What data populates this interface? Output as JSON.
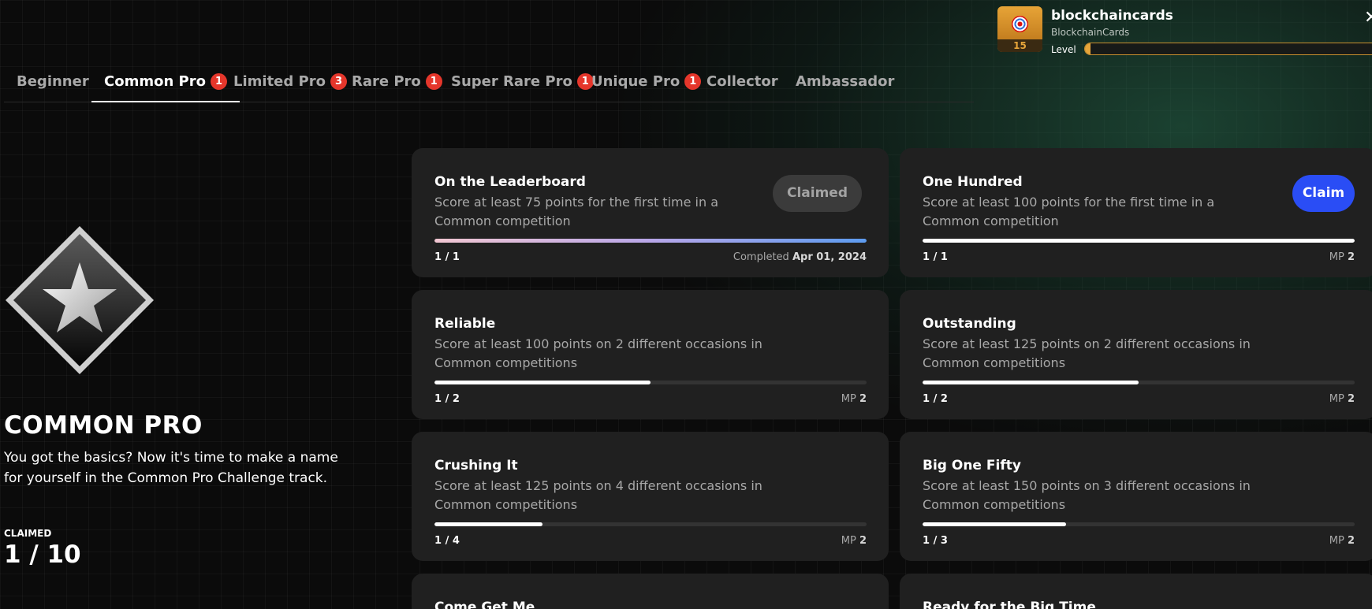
{
  "profile": {
    "name": "blockchaincards",
    "subtitle": "BlockchainCards",
    "level_label": "Level",
    "level": "15",
    "level_progress": 0.02
  },
  "tabs": [
    {
      "label": "Beginner",
      "badge": ""
    },
    {
      "label": "Common Pro",
      "badge": "1",
      "active": true
    },
    {
      "label": "Limited Pro",
      "badge": "3"
    },
    {
      "label": "Rare Pro",
      "badge": "1"
    },
    {
      "label": "Super Rare Pro",
      "badge": "1"
    },
    {
      "label": "Unique Pro",
      "badge": "1"
    },
    {
      "label": "Collector",
      "badge": ""
    },
    {
      "label": "Ambassador",
      "badge": ""
    }
  ],
  "track": {
    "title": "COMMON PRO",
    "description": "You got the basics? Now it's time to make a name for yourself in the Common Pro Challenge track.",
    "claimed_label": "CLAIMED",
    "claimed_value": "1 / 10"
  },
  "cards": [
    {
      "title": "On the Leaderboard",
      "desc": "Score at least 75 points for the first time in a Common competition",
      "progress": "1 / 1",
      "fraction": 1.0,
      "status_prefix": "Completed",
      "status_value": "Apr 01, 2024",
      "button": "Claimed"
    },
    {
      "title": "One Hundred",
      "desc": "Score at least 100 points for the first time in a Common competition",
      "progress": "1 / 1",
      "fraction": 1.0,
      "status_prefix": "MP",
      "status_value": "2",
      "button": "Claim"
    },
    {
      "title": "Reliable",
      "desc": "Score at least 100 points on 2 different occasions in Common competitions",
      "progress": "1 / 2",
      "fraction": 0.5,
      "status_prefix": "MP",
      "status_value": "2",
      "button": ""
    },
    {
      "title": "Outstanding",
      "desc": "Score at least 125 points on 2 different occasions in Common competitions",
      "progress": "1 / 2",
      "fraction": 0.5,
      "status_prefix": "MP",
      "status_value": "2",
      "button": ""
    },
    {
      "title": "Crushing It",
      "desc": "Score at least 125 points on 4 different occasions in Common competitions",
      "progress": "1 / 4",
      "fraction": 0.25,
      "status_prefix": "MP",
      "status_value": "2",
      "button": ""
    },
    {
      "title": "Big One Fifty",
      "desc": "Score at least 150 points on 3 different occasions in Common competitions",
      "progress": "1 / 3",
      "fraction": 0.333,
      "status_prefix": "MP",
      "status_value": "2",
      "button": ""
    },
    {
      "title": "Come Get Me",
      "desc": "",
      "progress": "",
      "fraction": null,
      "status_prefix": "",
      "status_value": "",
      "button": ""
    },
    {
      "title": "Ready for the Big Time",
      "desc": "",
      "progress": "",
      "fraction": null,
      "status_prefix": "",
      "status_value": "",
      "button": ""
    }
  ],
  "colors": {
    "accent_blue": "#2a4df5",
    "badge_red": "#e5362b",
    "level_gold": "#e6a53a"
  }
}
